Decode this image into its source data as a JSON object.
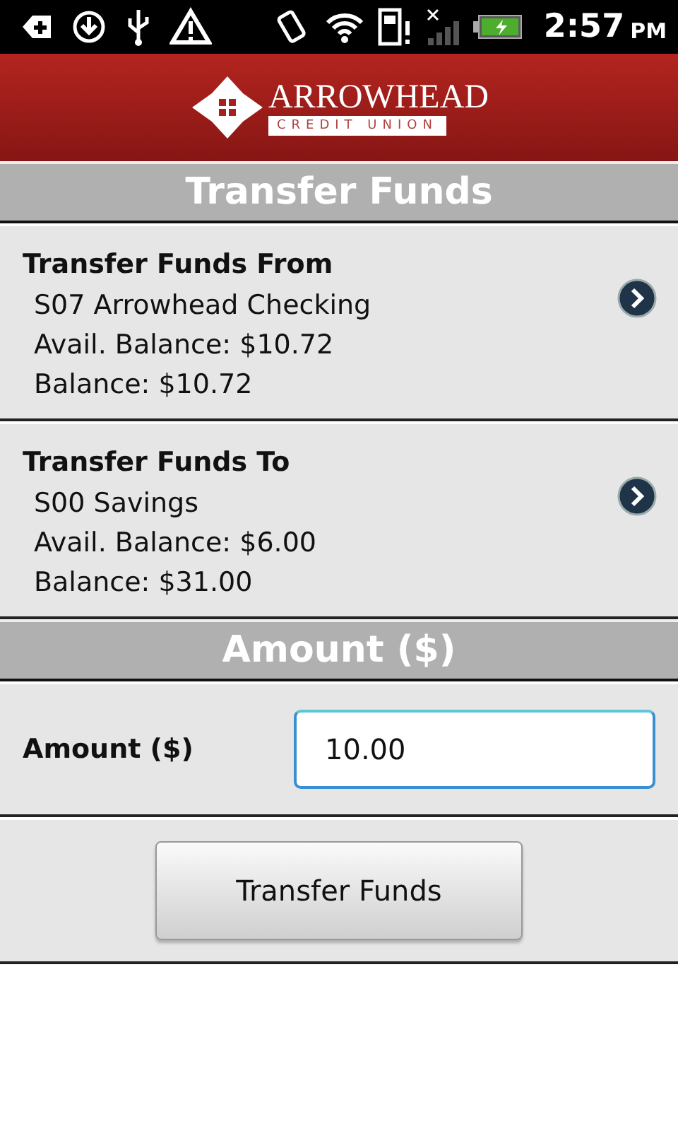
{
  "status_bar": {
    "time": "2:57",
    "meridiem": "PM"
  },
  "header": {
    "logo_name": "ARROWHEAD",
    "logo_tagline": "CREDIT UNION"
  },
  "title": "Transfer Funds",
  "accounts": [
    {
      "heading": "Transfer Funds From",
      "name": "S07 Arrowhead Checking",
      "available": "Avail. Balance: $10.72",
      "balance": "Balance: $10.72"
    },
    {
      "heading": "Transfer Funds To",
      "name": "S00 Savings",
      "available": "Avail. Balance: $6.00",
      "balance": "Balance: $31.00"
    }
  ],
  "amount_section": {
    "title": "Amount ($)",
    "label": "Amount ($)",
    "value": "10.00"
  },
  "submit_button": "Transfer Funds"
}
